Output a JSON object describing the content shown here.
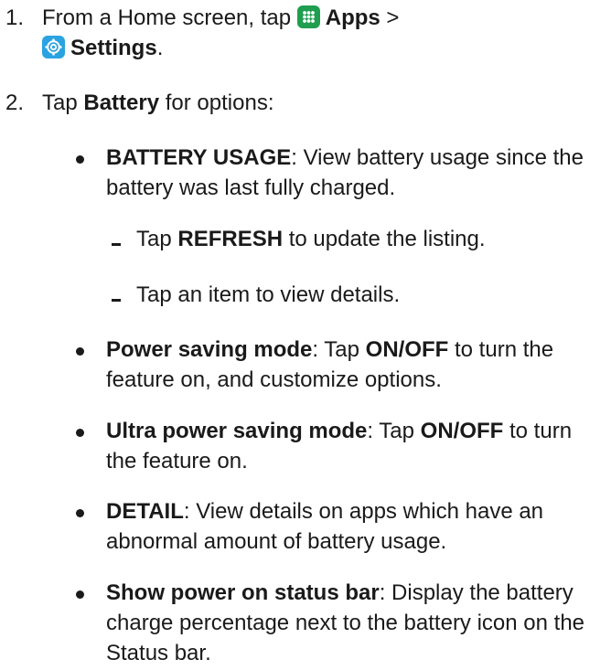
{
  "step1": {
    "number": "1.",
    "prefix": "From a Home screen, tap ",
    "apps_icon": "apps-grid-icon",
    "apps_label": "Apps",
    "separator": " >",
    "settings_icon": "settings-gear-icon",
    "settings_label": "Settings",
    "end": "."
  },
  "step2": {
    "number": "2.",
    "prefix": "Tap ",
    "battery_label": "Battery",
    "suffix": " for options:"
  },
  "bullets": [
    {
      "term": "BATTERY USAGE",
      "text": ": View battery usage since the battery was last fully charged."
    },
    {
      "term": "Power saving mode",
      "text_a": ": Tap ",
      "term_b": "ON/OFF",
      "text_b": " to turn the feature on, and customize options."
    },
    {
      "term": "Ultra power saving mode",
      "text_a": ": Tap ",
      "term_b": "ON/OFF",
      "text_b": " to turn the feature on."
    },
    {
      "term": "DETAIL",
      "text": ": View details on apps which have an abnormal amount of battery usage."
    },
    {
      "term": "Show power on status bar",
      "text": ": Display the battery charge percentage next to the battery icon on the Status bar."
    }
  ],
  "subitems": [
    {
      "prefix": "Tap ",
      "term": "REFRESH",
      "suffix": " to update the listing."
    },
    {
      "text": "Tap an item to view details."
    }
  ],
  "colors": {
    "apps_icon": "#1f9e4f",
    "settings_icon": "#2aa3e0",
    "text": "#1a1a1a"
  }
}
